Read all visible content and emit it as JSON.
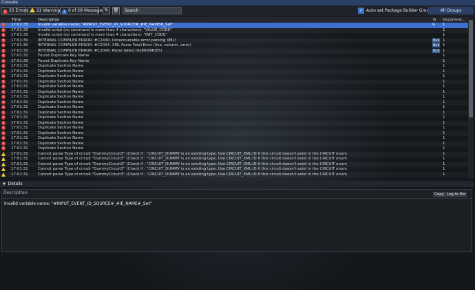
{
  "window": {
    "title": "Console"
  },
  "toolbar": {
    "errors_label": "25 Errors",
    "warnings_label": "22 Warnings",
    "messages_label": "0 of 28 Messages",
    "search_placeholder": "Search",
    "auto_set_label": "Auto set Package Builder Group",
    "group_select": "All Groups"
  },
  "table": {
    "headers": {
      "time": "Time",
      "description": "Description",
      "g": "G",
      "occurrences": "Occurrenc..."
    },
    "rows": [
      {
        "type": "error",
        "time": "17:01:35",
        "desc": "Invalid variable name: \"#INPUT_EVENT_ID_SOURCE#_#IE_NAME#_Set\"",
        "g": "G",
        "occ": "1",
        "selected": true
      },
      {
        "type": "error",
        "time": "17:01:35",
        "desc": "Invalid script (no command is more than 4 characters): \"VALUE_CODE\"",
        "g": "",
        "occ": "1"
      },
      {
        "type": "error",
        "time": "17:01:35",
        "desc": "Invalid script (no command is more than 4 characters): \"INIT_CODE\"",
        "g": "",
        "occ": "1"
      },
      {
        "type": "error",
        "time": "17:01:30",
        "desc": "INTERNAL COMPILER ERROR:  #C2430: Unrecoverable error parsing XML!",
        "g": "Buil",
        "occ": "1"
      },
      {
        "type": "error",
        "time": "17:01:30",
        "desc": "INTERNAL COMPILER ERROR:  #C2034: XML Parse Fatal Error (line, column, error)",
        "g": "Buil",
        "occ": "1"
      },
      {
        "type": "error",
        "time": "17:01:30",
        "desc": "INTERNAL COMPILER ERROR:  #C2006: Parse failed  (0x80004005)",
        "g": "Buil",
        "occ": "1"
      },
      {
        "type": "error",
        "time": "17:01:32",
        "desc": "Found Duplicate Key Name",
        "g": "",
        "occ": "1"
      },
      {
        "type": "error",
        "time": "17:01:30",
        "desc": "Found Duplicate Key Name",
        "g": "",
        "occ": "1"
      },
      {
        "type": "error",
        "time": "17:01:31",
        "desc": "Duplicate Section Name",
        "g": "",
        "occ": "1"
      },
      {
        "type": "error",
        "time": "17:01:31",
        "desc": "Duplicate Section Name",
        "g": "",
        "occ": "1"
      },
      {
        "type": "error",
        "time": "17:01:31",
        "desc": "Duplicate Section Name",
        "g": "",
        "occ": "1"
      },
      {
        "type": "error",
        "time": "17:01:31",
        "desc": "Duplicate Section Name",
        "g": "",
        "occ": "1"
      },
      {
        "type": "error",
        "time": "17:01:31",
        "desc": "Duplicate Section Name",
        "g": "",
        "occ": "1"
      },
      {
        "type": "error",
        "time": "17:01:31",
        "desc": "Duplicate Section Name",
        "g": "",
        "occ": "1"
      },
      {
        "type": "error",
        "time": "17:01:31",
        "desc": "Duplicate Section Name",
        "g": "",
        "occ": "1"
      },
      {
        "type": "error",
        "time": "17:01:31",
        "desc": "Duplicate Section Name",
        "g": "",
        "occ": "1"
      },
      {
        "type": "error",
        "time": "17:01:31",
        "desc": "Duplicate Section Name",
        "g": "",
        "occ": "1"
      },
      {
        "type": "error",
        "time": "17:01:31",
        "desc": "Duplicate Section Name",
        "g": "",
        "occ": "1"
      },
      {
        "type": "error",
        "time": "17:01:31",
        "desc": "Duplicate Section Name",
        "g": "",
        "occ": "1"
      },
      {
        "type": "error",
        "time": "17:01:31",
        "desc": "Duplicate Section Name",
        "g": "",
        "occ": "1"
      },
      {
        "type": "error",
        "time": "17:01:31",
        "desc": "Duplicate Section Name",
        "g": "",
        "occ": "1"
      },
      {
        "type": "error",
        "time": "17:01:31",
        "desc": "Duplicate Section Name",
        "g": "",
        "occ": "1"
      },
      {
        "type": "error",
        "time": "17:01:31",
        "desc": "Duplicate Section Name",
        "g": "",
        "occ": "1"
      },
      {
        "type": "error",
        "time": "17:01:31",
        "desc": "Duplicate Section Name",
        "g": "",
        "occ": "1"
      },
      {
        "type": "error",
        "time": "17:01:31",
        "desc": "Duplicate Section Name",
        "g": "",
        "occ": "1"
      },
      {
        "type": "warning",
        "time": "17:01:31",
        "desc": "Cannot parse Type of circuit \"DummyCircuit3\" (Check if : \"CIRCUIT_DUMMY is an existing type. Use CIRCUIT_XML:ID if this circuit doesn't exist in the CIRCUIT enum",
        "g": "",
        "occ": "1"
      },
      {
        "type": "warning",
        "time": "17:01:31",
        "desc": "Cannot parse Type of circuit \"DummyCircuit3\" (Check if : \"CIRCUIT_DUMMY is an existing type. Use CIRCUIT_XML:ID if this circuit doesn't exist in the CIRCUIT enum",
        "g": "",
        "occ": "1"
      },
      {
        "type": "warning",
        "time": "17:01:31",
        "desc": "Cannot parse Type of circuit \"DummyCircuit3\" (Check if : \"CIRCUIT_DUMMY is an existing type. Use CIRCUIT_XML:ID if this circuit doesn't exist in the CIRCUIT enum",
        "g": "",
        "occ": "1"
      },
      {
        "type": "warning",
        "time": "17:01:31",
        "desc": "Cannot parse Type of circuit \"DummyCircuit3\" (Check if : \"CIRCUIT_DUMMY is an existing type. Use CIRCUIT_XML:ID if this circuit doesn't exist in the CIRCUIT enum",
        "g": "",
        "occ": "1"
      },
      {
        "type": "warning",
        "time": "17:01:31",
        "desc": "Cannot parse Type of circuit \"DummyCircuit3\" (Check if : \"CIRCUIT_DUMMY is an existing type. Use CIRCUIT_XML:ID if this circuit doesn't exist in the CIRCUIT enum",
        "g": "",
        "occ": "1"
      }
    ]
  },
  "details": {
    "title": "Details",
    "description_label": "Description:",
    "copy_label": "Copy",
    "log_label": "Log to file",
    "text": "Invalid variable name: \"#INPUT_EVENT_ID_SOURCE#_#IE_NAME#_Set\""
  },
  "colors": {
    "accent": "#3d6fd0",
    "error": "#d23a3a",
    "warning": "#f0c93a",
    "titlebar": "#2a3f66"
  }
}
